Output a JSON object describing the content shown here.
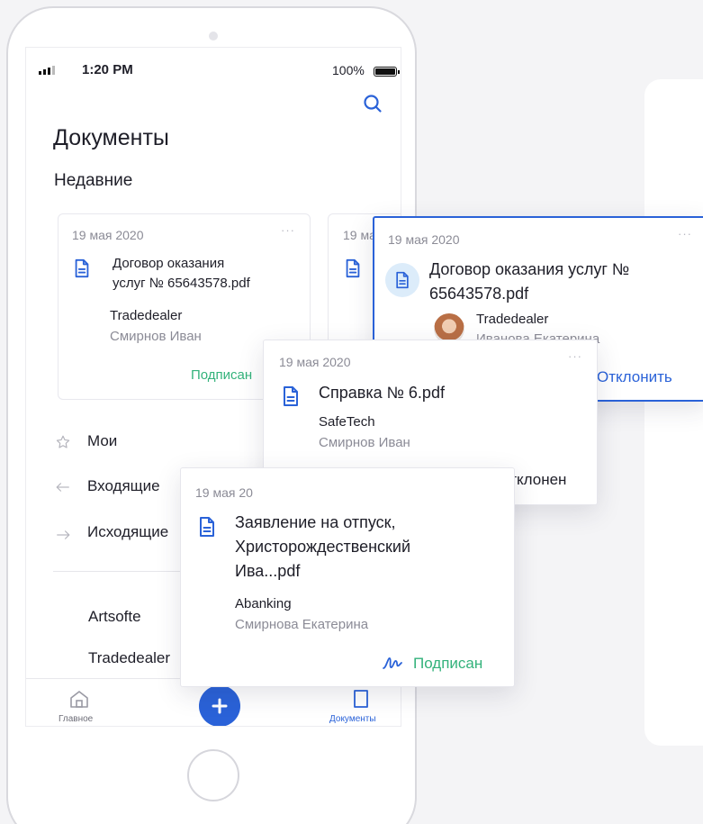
{
  "status_bar": {
    "time": "1:20 PM",
    "battery": "100%"
  },
  "header": {
    "title": "Документы",
    "section": "Недавние"
  },
  "recent_card": {
    "date": "19 мая 2020",
    "dots": "···",
    "file_line1": "Договор оказания",
    "file_line2": "услуг № 65643578.pdf",
    "company": "Tradedealer",
    "person": "Смирнов Иван",
    "status": "Подписан"
  },
  "recent_card_2": {
    "date": "19 ма"
  },
  "nav": [
    {
      "label": "Мои",
      "icon": "star-icon"
    },
    {
      "label": "Входящие",
      "icon": "arrow-left-icon"
    },
    {
      "label": "Исходящие",
      "icon": "arrow-right-icon"
    }
  ],
  "companies": [
    "Artsofte",
    "Tradedealer"
  ],
  "tab_bar": {
    "home": "Главное",
    "documents": "Документы"
  },
  "popup_contract": {
    "date": "19 мая 2020",
    "dots": "···",
    "file_line1": "Договор оказания услуг №",
    "file_line2": "65643578.pdf",
    "company": "Tradedealer",
    "person": "Иванова Екатерина",
    "action": "Отклонить"
  },
  "popup_certificate": {
    "date": "19 мая 2020",
    "dots": "···",
    "file": "Справка № 6.pdf",
    "company": "SafeTech",
    "person": "Смирнов Иван",
    "status": "Отклонен"
  },
  "popup_vacation": {
    "date": "19 мая 20",
    "file_line1": "Заявление на отпуск,",
    "file_line2": "Христорождественский",
    "file_line3": "Ива...pdf",
    "company": "Abanking",
    "person": "Смирнова Екатерина",
    "status": "Подписан"
  },
  "colors": {
    "accent": "#2a62d8",
    "signed": "#33b27b",
    "rejected": "#f04848",
    "muted": "#8b8b96"
  }
}
